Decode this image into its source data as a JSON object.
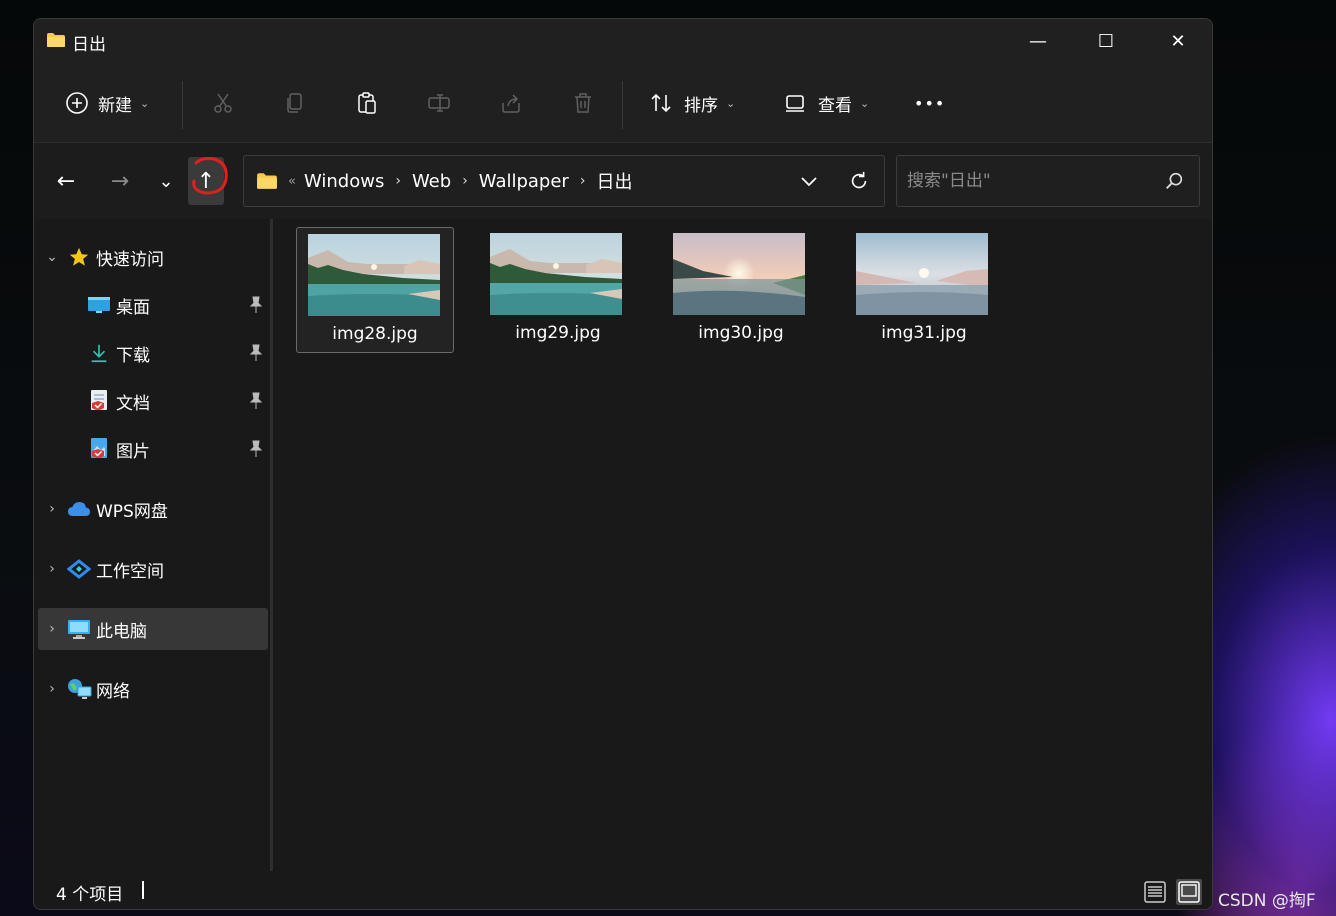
{
  "window": {
    "title": "日出",
    "controls": {
      "minimize": "—",
      "maximize": "☐",
      "close": "✕"
    }
  },
  "toolbar": {
    "new_label": "新建",
    "sort_label": "排序",
    "view_label": "查看",
    "more_label": "•••",
    "icons": [
      "plus-circle-icon",
      "cut-icon",
      "copy-icon",
      "paste-icon",
      "rename-icon",
      "share-icon",
      "delete-icon",
      "sort-icon",
      "view-icon",
      "more-icon"
    ]
  },
  "nav": {
    "back": "←",
    "forward": "→",
    "recent": "⌄",
    "up": "↑",
    "path_overflow": "«",
    "breadcrumbs": [
      "Windows",
      "Web",
      "Wallpaper",
      "日出"
    ],
    "crumb_separator": "›",
    "dropdown": "⌄",
    "refresh": "↻"
  },
  "search": {
    "placeholder": "搜索\"日出\"",
    "value": ""
  },
  "sidebar": {
    "quick_access": {
      "label": "快速访问",
      "expanded": true
    },
    "pinned": [
      {
        "label": "桌面",
        "icon": "desktop-icon"
      },
      {
        "label": "下载",
        "icon": "download-icon"
      },
      {
        "label": "文档",
        "icon": "documents-icon"
      },
      {
        "label": "图片",
        "icon": "pictures-icon"
      }
    ],
    "roots": [
      {
        "label": "WPS网盘",
        "icon": "cloud-icon"
      },
      {
        "label": "工作空间",
        "icon": "workspace-icon"
      },
      {
        "label": "此电脑",
        "icon": "computer-icon",
        "selected": true
      },
      {
        "label": "网络",
        "icon": "network-icon"
      }
    ]
  },
  "files": [
    {
      "name": "img28.jpg",
      "selected": true
    },
    {
      "name": "img29.jpg",
      "selected": false
    },
    {
      "name": "img30.jpg",
      "selected": false
    },
    {
      "name": "img31.jpg",
      "selected": false
    }
  ],
  "status": {
    "text": "4 个项目",
    "view_modes": [
      "details-view-icon",
      "large-icons-view-icon"
    ]
  },
  "watermark": "CSDN @掏F",
  "colors": {
    "background": "#191919",
    "toolbar": "#202020",
    "selected": "#373737",
    "folder": "#f8c94a",
    "annotation": "#e02020"
  }
}
